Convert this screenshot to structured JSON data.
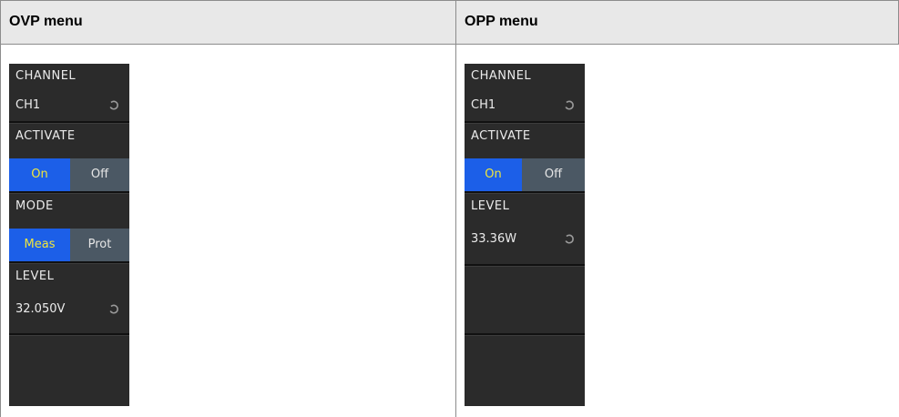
{
  "table": {
    "col1_header": "OVP menu",
    "col2_header": "OPP menu"
  },
  "ovp_menu": {
    "channel": {
      "label": "CHANNEL",
      "value": "CH1"
    },
    "activate": {
      "label": "ACTIVATE",
      "on": "On",
      "off": "Off",
      "selected": "On"
    },
    "mode": {
      "label": "MODE",
      "meas": "Meas",
      "prot": "Prot",
      "selected": "Meas"
    },
    "level": {
      "label": "LEVEL",
      "value": "32.050V"
    }
  },
  "opp_menu": {
    "channel": {
      "label": "CHANNEL",
      "value": "CH1"
    },
    "activate": {
      "label": "ACTIVATE",
      "on": "On",
      "off": "Off",
      "selected": "On"
    },
    "level": {
      "label": "LEVEL",
      "value": "33.36W"
    }
  },
  "colors": {
    "panel_bg": "#2b2b2b",
    "active_bg": "#1c5fe8",
    "active_text": "#f0e63c",
    "inactive_bg": "#4b5864"
  },
  "icons": {
    "rotary_knob": "rotary-knob-icon"
  }
}
